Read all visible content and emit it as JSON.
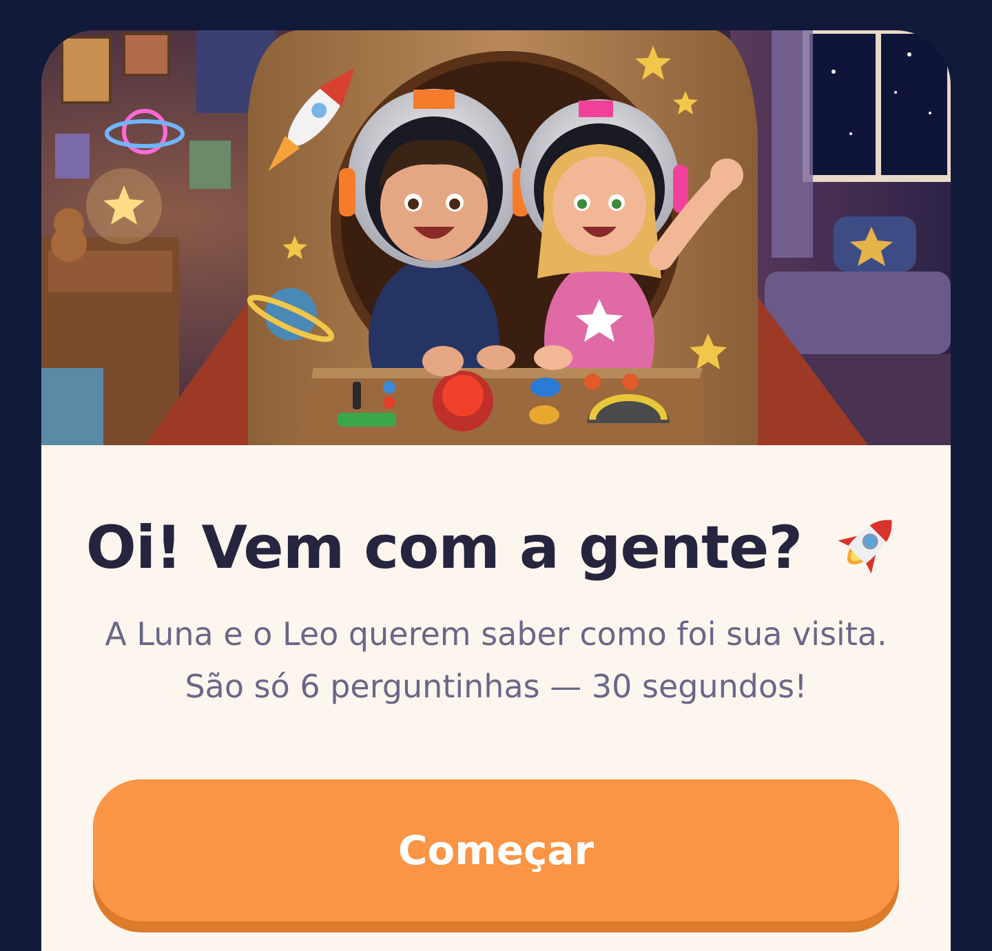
{
  "hero": {
    "image_description_icon": "kids-in-cardboard-rocket-illustration"
  },
  "welcome": {
    "title": "Oi! Vem com a gente?",
    "title_emoji_icon": "rocket-icon",
    "subtitle": "A Luna e o Leo querem saber como foi sua visita. São só 6 perguntinhas — 30 segundos!"
  },
  "cta": {
    "label": "Começar"
  },
  "colors": {
    "page_background": "#121a3a",
    "card_background": "#fdf6ee",
    "title": "#26243f",
    "subtitle": "#6a6688",
    "button": "#fb9444",
    "button_shadow": "#dc7b2a"
  }
}
